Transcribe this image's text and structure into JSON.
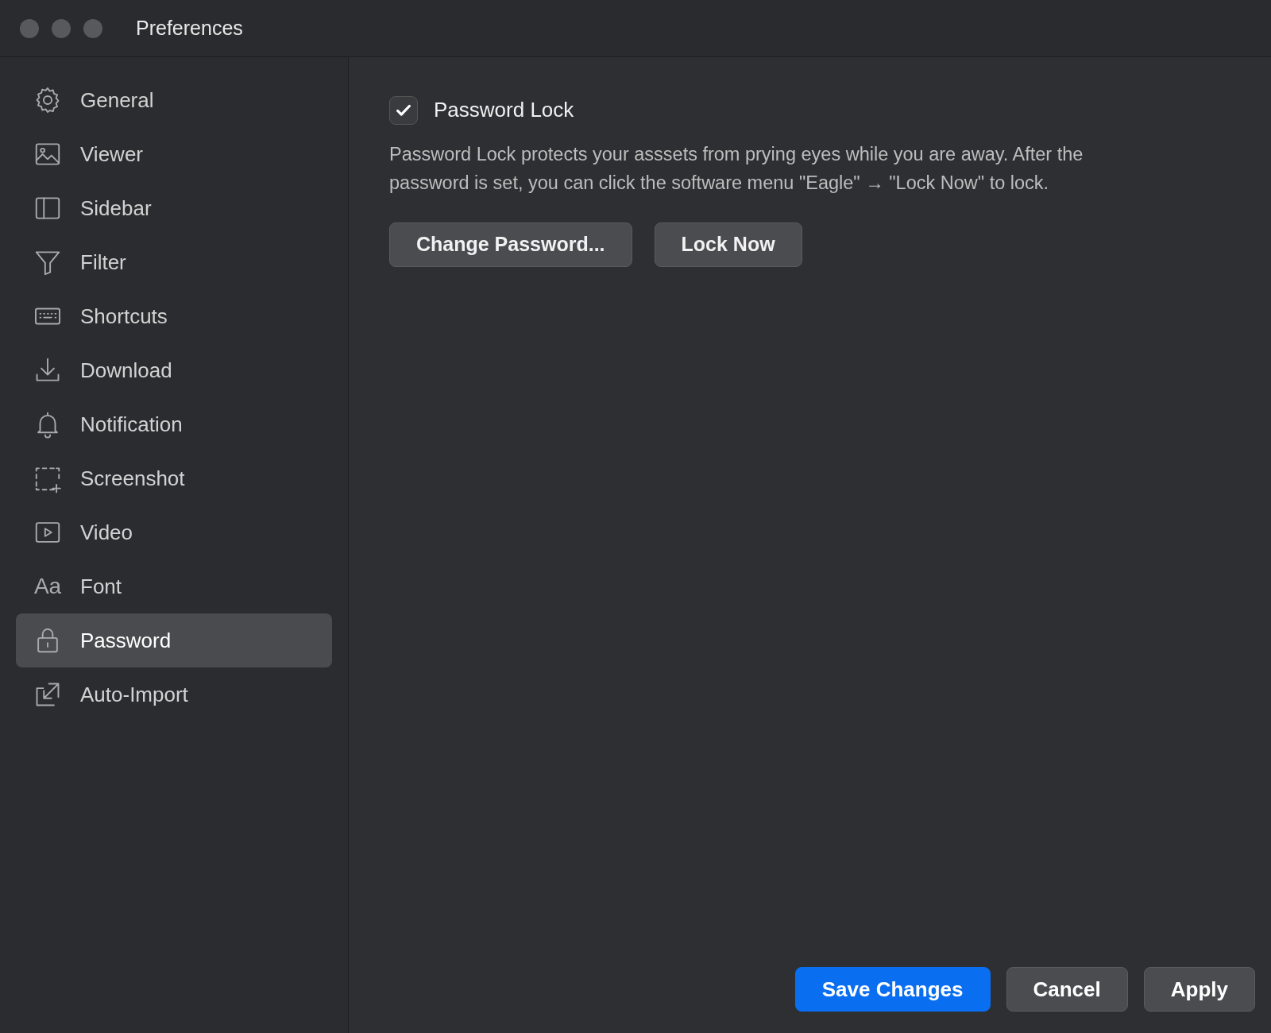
{
  "window": {
    "title": "Preferences"
  },
  "sidebar": {
    "items": [
      {
        "label": "General",
        "selected": false
      },
      {
        "label": "Viewer",
        "selected": false
      },
      {
        "label": "Sidebar",
        "selected": false
      },
      {
        "label": "Filter",
        "selected": false
      },
      {
        "label": "Shortcuts",
        "selected": false
      },
      {
        "label": "Download",
        "selected": false
      },
      {
        "label": "Notification",
        "selected": false
      },
      {
        "label": "Screenshot",
        "selected": false
      },
      {
        "label": "Video",
        "selected": false
      },
      {
        "label": "Font",
        "selected": false,
        "icon_text": "Aa"
      },
      {
        "label": "Password",
        "selected": true
      },
      {
        "label": "Auto-Import",
        "selected": false
      }
    ]
  },
  "password_lock": {
    "label": "Password Lock",
    "checked": true,
    "description": "Password Lock protects your asssets from prying eyes while you are away. After the password is set, you can click the software menu \"Eagle\" → \"Lock Now\" to lock.",
    "buttons": [
      "Change Password...",
      "Lock Now"
    ]
  },
  "footer_buttons": [
    {
      "label": "Save Changes",
      "kind": "primary"
    },
    {
      "label": "Cancel",
      "kind": "secondary"
    },
    {
      "label": "Apply",
      "kind": "secondary"
    }
  ]
}
